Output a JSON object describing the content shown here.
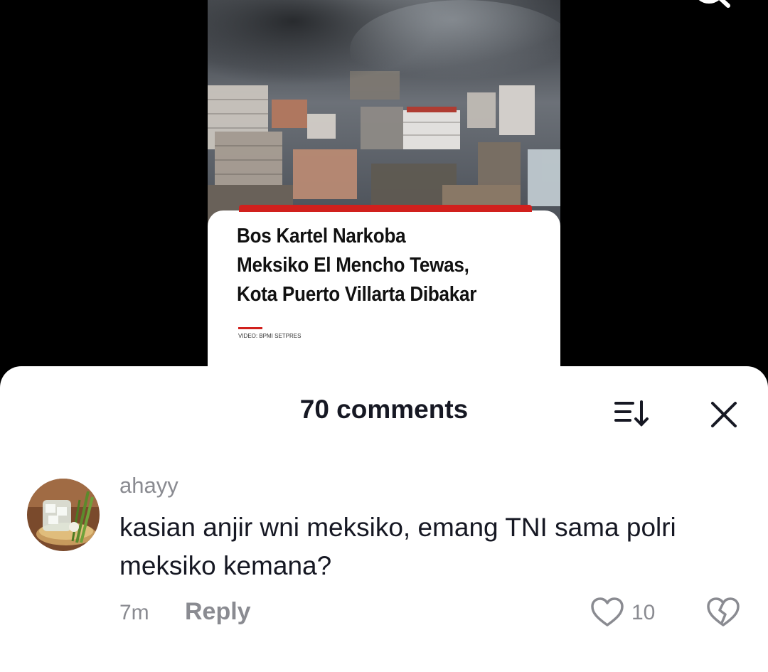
{
  "video": {
    "headline": "Bos Kartel Narkoba\nMeksiko El Mencho Tewas,\nKota Puerto Villarta Dibakar",
    "credit": "VIDEO: BPMI SETPRES",
    "accent_color": "#d1201d"
  },
  "header": {
    "search_icon": "search-icon"
  },
  "comments_sheet": {
    "title": "70 comments",
    "sort_icon": "sort-icon",
    "close_icon": "close-icon",
    "comments": [
      {
        "username": "ahayy",
        "text": "kasian anjir wni meksiko, emang TNI sama polri meksiko kemana?",
        "time": "7m",
        "reply_label": "Reply",
        "likes": "10"
      }
    ]
  }
}
